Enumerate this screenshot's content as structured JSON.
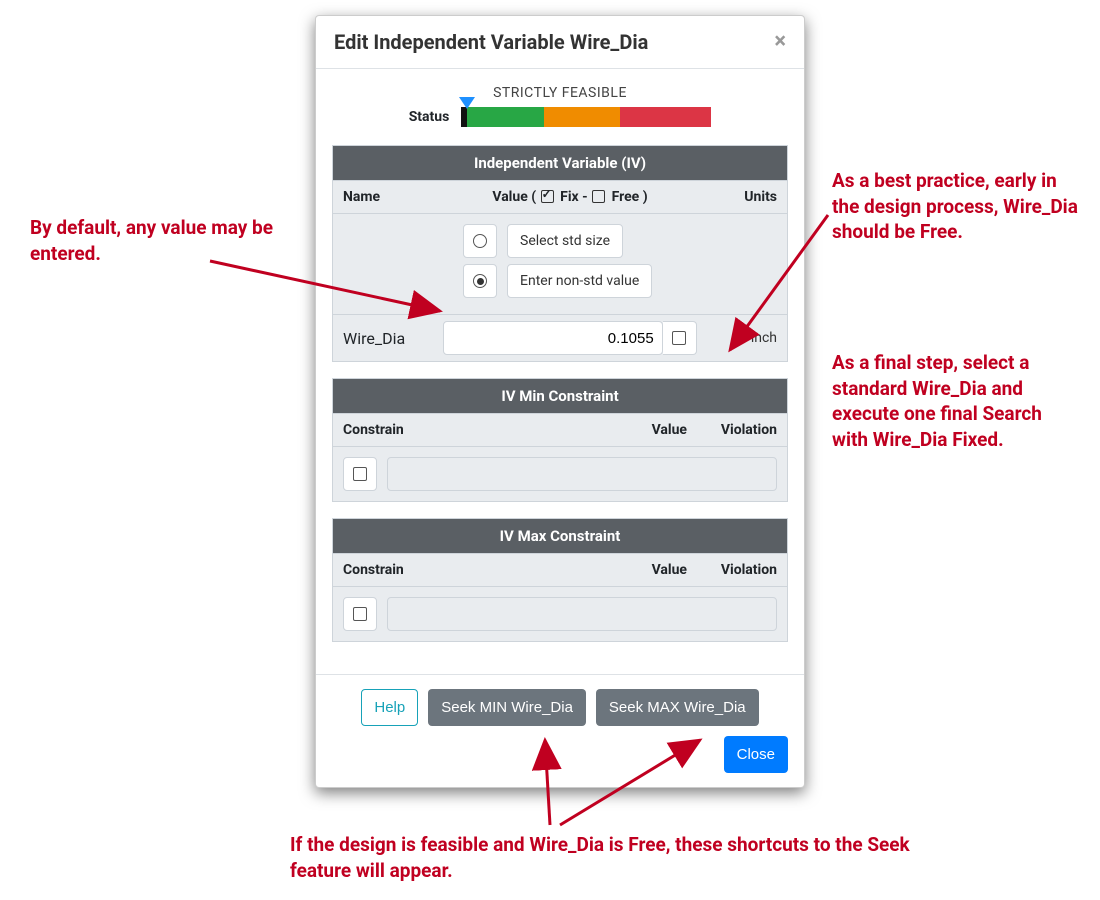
{
  "modal": {
    "title": "Edit Independent Variable Wire_Dia",
    "status_title": "STRICTLY FEASIBLE",
    "status_label": "Status"
  },
  "iv_section": {
    "header": "Independent Variable (IV)",
    "col_name": "Name",
    "col_value_prefix": "Value ( ",
    "col_value_fix": " Fix - ",
    "col_value_free": " Free )",
    "col_units": "Units",
    "radio_std_label": "Select std size",
    "radio_nonstd_label": "Enter non-std value",
    "radio_selected": "nonstd",
    "var_name": "Wire_Dia",
    "var_value": "0.1055",
    "fix_checked": false,
    "units": "inch"
  },
  "min_section": {
    "header": "IV Min Constraint",
    "col_constrain": "Constrain",
    "col_value": "Value",
    "col_violation": "Violation",
    "checked": false,
    "value": ""
  },
  "max_section": {
    "header": "IV Max Constraint",
    "col_constrain": "Constrain",
    "col_value": "Value",
    "col_violation": "Violation",
    "checked": false,
    "value": ""
  },
  "footer": {
    "help": "Help",
    "seek_min": "Seek MIN Wire_Dia",
    "seek_max": "Seek MAX Wire_Dia",
    "close": "Close"
  },
  "annotations": {
    "left": "By default, any value may be entered.",
    "right1": "As a best practice, early in the design process, Wire_Dia should be Free.",
    "right2": "As a final step, select a standard Wire_Dia and execute one final Search with Wire_Dia Fixed.",
    "bottom": "If the design is feasible and Wire_Dia is Free, these shortcuts to the Seek feature will appear."
  }
}
